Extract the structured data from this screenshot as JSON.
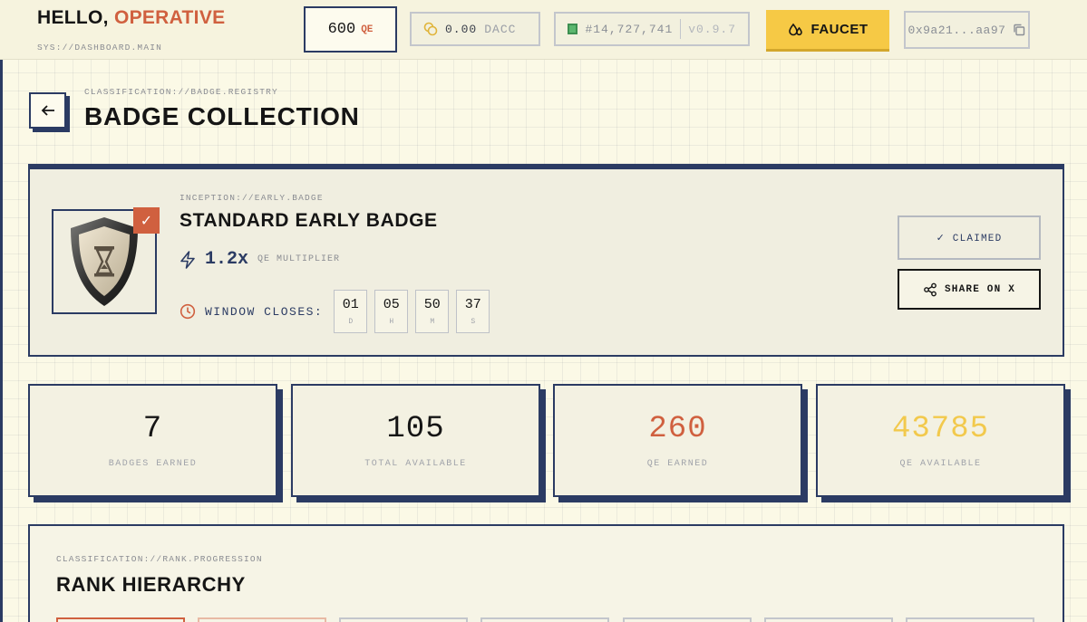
{
  "header": {
    "greeting": "HELLO,",
    "greeting_name": "OPERATIVE",
    "sys_path": "SYS://DASHBOARD.MAIN",
    "qe_balance": "600",
    "qe_unit": "QE",
    "dacc_balance": "0.00",
    "dacc_unit": "DACC",
    "block_number": "#14,727,741",
    "version": "v0.9.7",
    "faucet_label": "FAUCET",
    "wallet_address": "0x9a21...aa97"
  },
  "page": {
    "kicker": "CLASSIFICATION://BADGE.REGISTRY",
    "title": "BADGE COLLECTION"
  },
  "badge": {
    "kicker": "INCEPTION://EARLY.BADGE",
    "title": "STANDARD EARLY BADGE",
    "multiplier": "1.2x",
    "multiplier_label": "QE MULTIPLIER",
    "window_label": "WINDOW CLOSES:",
    "countdown": [
      {
        "value": "01",
        "unit": "D"
      },
      {
        "value": "05",
        "unit": "H"
      },
      {
        "value": "50",
        "unit": "M"
      },
      {
        "value": "37",
        "unit": "S"
      }
    ],
    "claimed_label": "✓ CLAIMED",
    "share_label": "SHARE ON X"
  },
  "stats": [
    {
      "value": "7",
      "label": "BADGES EARNED",
      "color": "#151515"
    },
    {
      "value": "105",
      "label": "TOTAL AVAILABLE",
      "color": "#151515"
    },
    {
      "value": "260",
      "label": "QE EARNED",
      "color": "#d0603f"
    },
    {
      "value": "43785",
      "label": "QE AVAILABLE",
      "color": "#f2c94c"
    }
  ],
  "rank": {
    "kicker": "CLASSIFICATION://RANK.PROGRESSION",
    "title": "RANK HIERARCHY"
  },
  "colors": {
    "accent": "#d0603f",
    "navy": "#2b3b63",
    "yellow": "#f6c945",
    "background": "#fbf9e6"
  }
}
